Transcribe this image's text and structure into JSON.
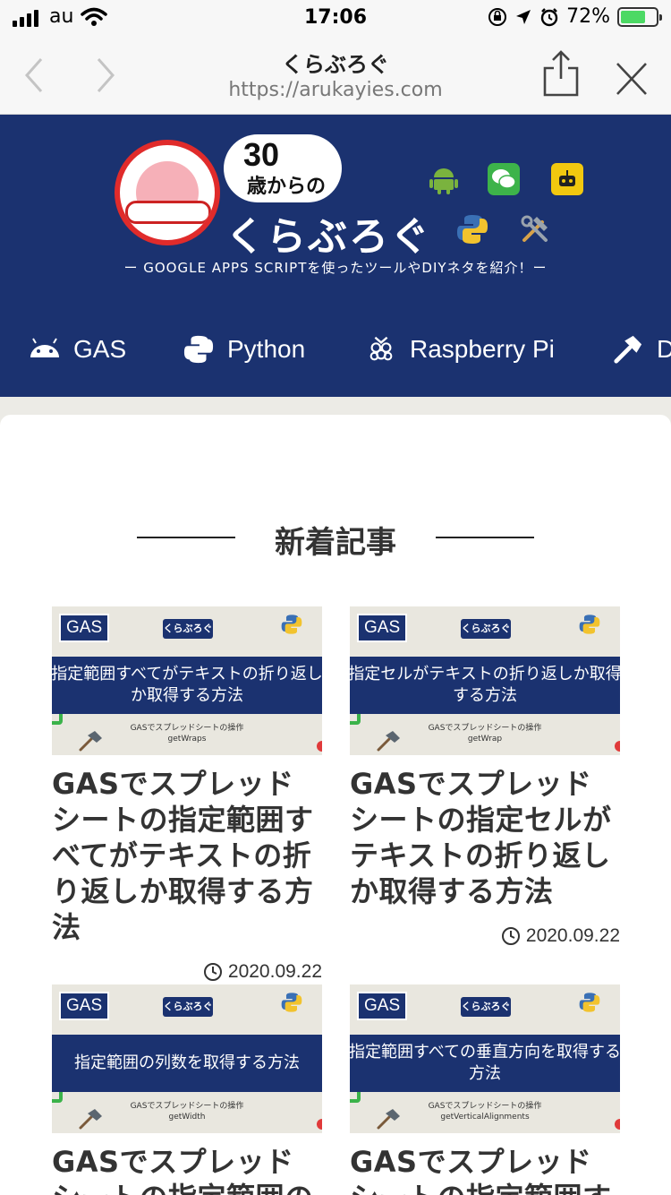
{
  "status_bar": {
    "carrier": "au",
    "time": "17:06",
    "battery": "72%",
    "battery_level": 0.72
  },
  "browser": {
    "title": "くらぶろぐ",
    "url": "https://arukayies.com"
  },
  "header": {
    "logo_number": "30",
    "logo_sub": "歳からの",
    "brand": "くらぶろぐ",
    "tagline": "ー GOOGLE APPS SCRIPTを使ったツールやDIYネタを紹介！ー",
    "icons": [
      "android-icon",
      "wechat-icon",
      "robot-icon",
      "python-icon",
      "tools-icon"
    ]
  },
  "categories": [
    {
      "label": "GAS",
      "icon": "android-icon"
    },
    {
      "label": "Python",
      "icon": "python-icon"
    },
    {
      "label": "Raspberry Pi",
      "icon": "raspberry-icon"
    },
    {
      "label": "D",
      "icon": "hammer-icon"
    }
  ],
  "section": {
    "title": "新着記事"
  },
  "posts": [
    {
      "tag": "GAS",
      "logo": "くらぶろぐ",
      "band_lines": [
        "指定範囲すべてがテキストの折り返し",
        "か取得する方法"
      ],
      "sub_lines": [
        "GASでスプレッドシートの操作",
        "getWraps"
      ],
      "title": "GASでスプレッドシートの指定範囲すべてがテキストの折り返しか取得する方法",
      "date": "2020.09.22"
    },
    {
      "tag": "GAS",
      "logo": "くらぶろぐ",
      "band_lines": [
        "指定セルがテキストの折り返しか取得",
        "する方法"
      ],
      "sub_lines": [
        "GASでスプレッドシートの操作",
        "getWrap"
      ],
      "title": "GASでスプレッドシートの指定セルがテキストの折り返しか取得する方法",
      "date": "2020.09.22"
    },
    {
      "tag": "GAS",
      "logo": "くらぶろぐ",
      "band_lines": [
        "指定範囲の列数を取得する方法"
      ],
      "sub_lines": [
        "GASでスプレッドシートの操作",
        "getWidth"
      ],
      "title": "GASでスプレッドシートの指定範囲の列",
      "date": ""
    },
    {
      "tag": "GAS",
      "logo": "くらぶろぐ",
      "band_lines": [
        "指定範囲すべての垂直方向を取得する",
        "方法"
      ],
      "sub_lines": [
        "GASでスプレッドシートの操作",
        "getVerticalAlignments"
      ],
      "title": "GASでスプレッドシートの指定範囲すべ",
      "date": ""
    }
  ],
  "colors": {
    "header_bg": "#1b3270",
    "accent_red": "#e02b2b",
    "page_bg": "#ecebe6",
    "battery": "#4cd964"
  }
}
